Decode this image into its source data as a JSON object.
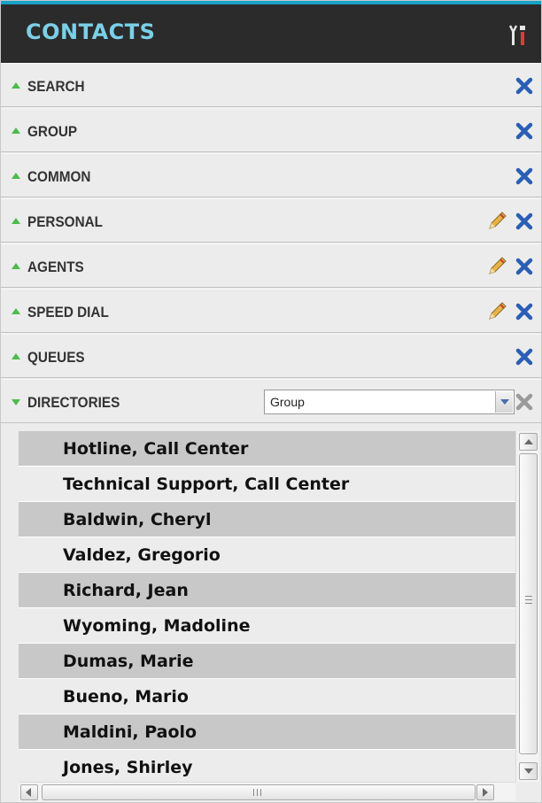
{
  "header": {
    "title": "CONTACTS",
    "tools_icon": "tools-icon"
  },
  "colors": {
    "accent": "#1aa0c8",
    "title": "#7ad0e8",
    "arrow": "#4cbb4c",
    "close_active": "#2a5fb4",
    "close_disabled": "#9a9a9a"
  },
  "sections": [
    {
      "label": "SEARCH",
      "editable": false
    },
    {
      "label": "GROUP",
      "editable": false
    },
    {
      "label": "COMMON",
      "editable": false
    },
    {
      "label": "PERSONAL",
      "editable": true
    },
    {
      "label": "AGENTS",
      "editable": true
    },
    {
      "label": "SPEED DIAL",
      "editable": true
    },
    {
      "label": "QUEUES",
      "editable": false
    },
    {
      "label": "DIRECTORIES",
      "expanded": true
    }
  ],
  "directories": {
    "filter_value": "Group",
    "contacts": [
      "Hotline, Call Center",
      "Technical Support, Call Center",
      "Baldwin, Cheryl",
      "Valdez, Gregorio",
      "Richard, Jean",
      "Wyoming, Madoline",
      "Dumas, Marie",
      "Bueno, Mario",
      "Maldini, Paolo",
      "Jones, Shirley"
    ]
  }
}
